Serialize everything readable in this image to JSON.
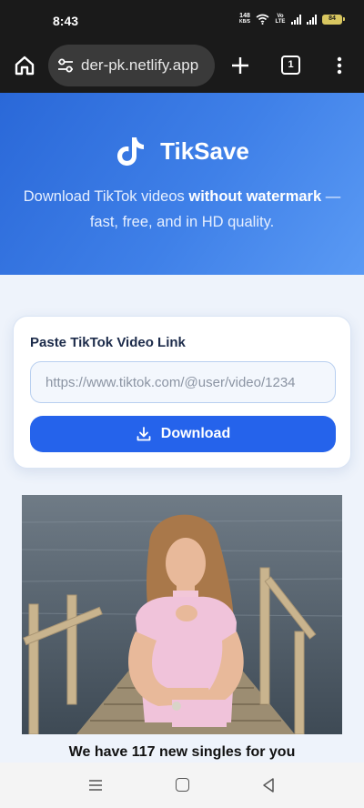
{
  "status_bar": {
    "time": "8:43",
    "net_speed_value": "148",
    "net_speed_unit": "KB/S",
    "volte": "Vo LTE",
    "battery": "84"
  },
  "browser": {
    "url": "der-pk.netlify.app",
    "tab_count": "1"
  },
  "hero": {
    "brand": "TikSave",
    "tagline_start": "Download TikTok videos ",
    "tagline_bold": "without watermark",
    "tagline_end": " — fast, free, and in HD quality."
  },
  "form": {
    "label": "Paste TikTok Video Link",
    "placeholder": "https://www.tiktok.com/@user/video/1234",
    "button_label": "Download"
  },
  "ad": {
    "caption": "We have 117 new singles for you"
  },
  "colors": {
    "accent": "#2563eb",
    "hero_start": "#2a68d8",
    "hero_end": "#5a9af4",
    "page_bg": "#eef3fb"
  }
}
